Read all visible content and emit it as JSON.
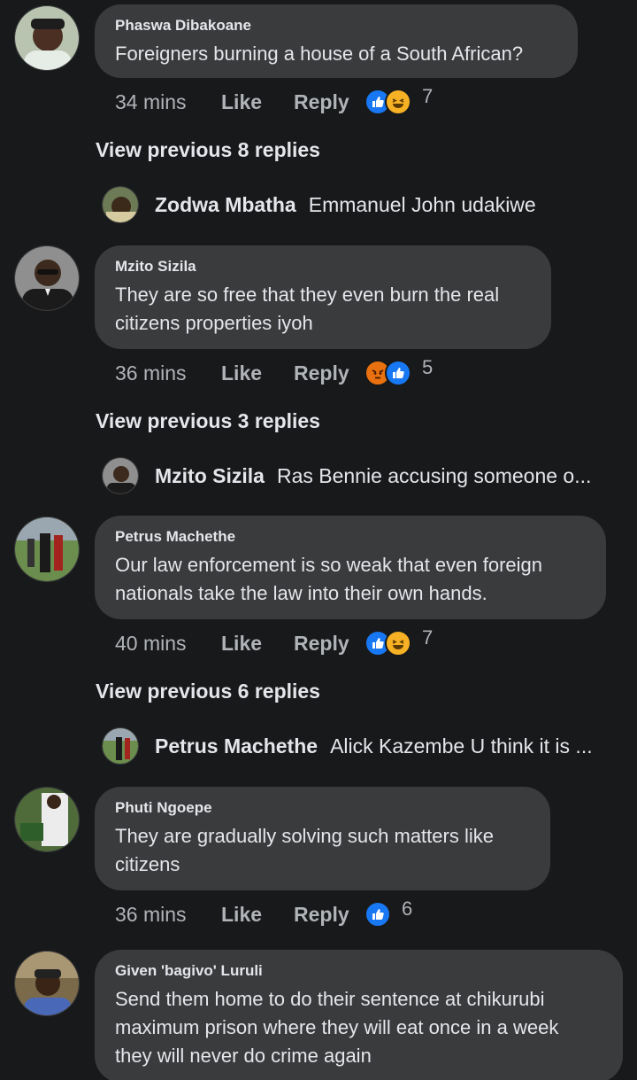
{
  "comments": [
    {
      "author": "Phaswa Dibakoane",
      "lines": [
        "Foreigners burning a house of a South African?"
      ],
      "time": "34 mins",
      "like_label": "Like",
      "reply_label": "Reply",
      "reactions": [
        "like",
        "haha"
      ],
      "reaction_count": "7",
      "view_previous": "View previous 8 replies",
      "reply_preview": {
        "author": "Zodwa Mbatha",
        "text": "Emmanuel John udakiwe"
      }
    },
    {
      "author": "Mzito Sizila",
      "lines": [
        "They are so free that they even burn the real",
        "citizens properties iyoh"
      ],
      "time": "36 mins",
      "like_label": "Like",
      "reply_label": "Reply",
      "reactions": [
        "angry",
        "like"
      ],
      "reaction_count": "5",
      "view_previous": "View previous 3 replies",
      "reply_preview": {
        "author": "Mzito Sizila",
        "text": "Ras Bennie accusing someone o..."
      }
    },
    {
      "author": "Petrus Machethe",
      "lines": [
        "Our law enforcement is so weak that even foreign",
        "nationals take the law into their own hands."
      ],
      "time": "40 mins",
      "like_label": "Like",
      "reply_label": "Reply",
      "reactions": [
        "like",
        "haha"
      ],
      "reaction_count": "7",
      "view_previous": "View previous 6 replies",
      "reply_preview": {
        "author": "Petrus Machethe",
        "text": "Alick Kazembe U think it is ..."
      }
    },
    {
      "author": "Phuti Ngoepe",
      "lines": [
        "They are gradually solving such matters like",
        "citizens"
      ],
      "time": "36 mins",
      "like_label": "Like",
      "reply_label": "Reply",
      "reactions": [
        "like"
      ],
      "reaction_count": "6"
    },
    {
      "author": "Given 'bagivo' Luruli",
      "lines": [
        "Send them home to do their sentence at chikurubi",
        "maximum prison where they will eat once in a week",
        "they will never do crime again"
      ]
    }
  ],
  "colors": {
    "background": "#18191a",
    "bubble": "#3a3b3c",
    "like_blue": "#1877f2",
    "haha_yellow": "#f7b125",
    "angry_orange": "#e9710f"
  }
}
